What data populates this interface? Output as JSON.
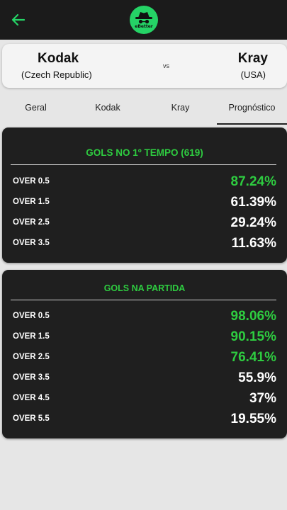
{
  "header": {
    "logo_text": "eBetter",
    "colors": {
      "bar": "#1b1b1b",
      "accent": "#25d366"
    }
  },
  "match": {
    "home": {
      "name": "Kodak",
      "country": "(Czech Republic)"
    },
    "vs": "vs",
    "away": {
      "name": "Kray",
      "country": "(USA)"
    }
  },
  "tabs": [
    {
      "label": "Geral",
      "active": false
    },
    {
      "label": "Kodak",
      "active": false
    },
    {
      "label": "Kray",
      "active": false
    },
    {
      "label": "Prognóstico",
      "active": true
    }
  ],
  "first_half": {
    "title": "GOLS NO 1º TEMPO (619)",
    "rows": [
      {
        "label": "OVER 0.5",
        "value": "87.24%",
        "highlight": true
      },
      {
        "label": "OVER 1.5",
        "value": "61.39%",
        "highlight": false
      },
      {
        "label": "OVER 2.5",
        "value": "29.24%",
        "highlight": false
      },
      {
        "label": "OVER 3.5",
        "value": "11.63%",
        "highlight": false
      }
    ]
  },
  "full_match": {
    "title": "GOLS NA PARTIDA",
    "rows": [
      {
        "label": "OVER 0.5",
        "value": "98.06%",
        "highlight": true
      },
      {
        "label": "OVER 1.5",
        "value": "90.15%",
        "highlight": true
      },
      {
        "label": "OVER 2.5",
        "value": "76.41%",
        "highlight": true
      },
      {
        "label": "OVER 3.5",
        "value": "55.9%",
        "highlight": false
      },
      {
        "label": "OVER 4.5",
        "value": "37%",
        "highlight": false
      },
      {
        "label": "OVER 5.5",
        "value": "19.55%",
        "highlight": false
      }
    ]
  }
}
